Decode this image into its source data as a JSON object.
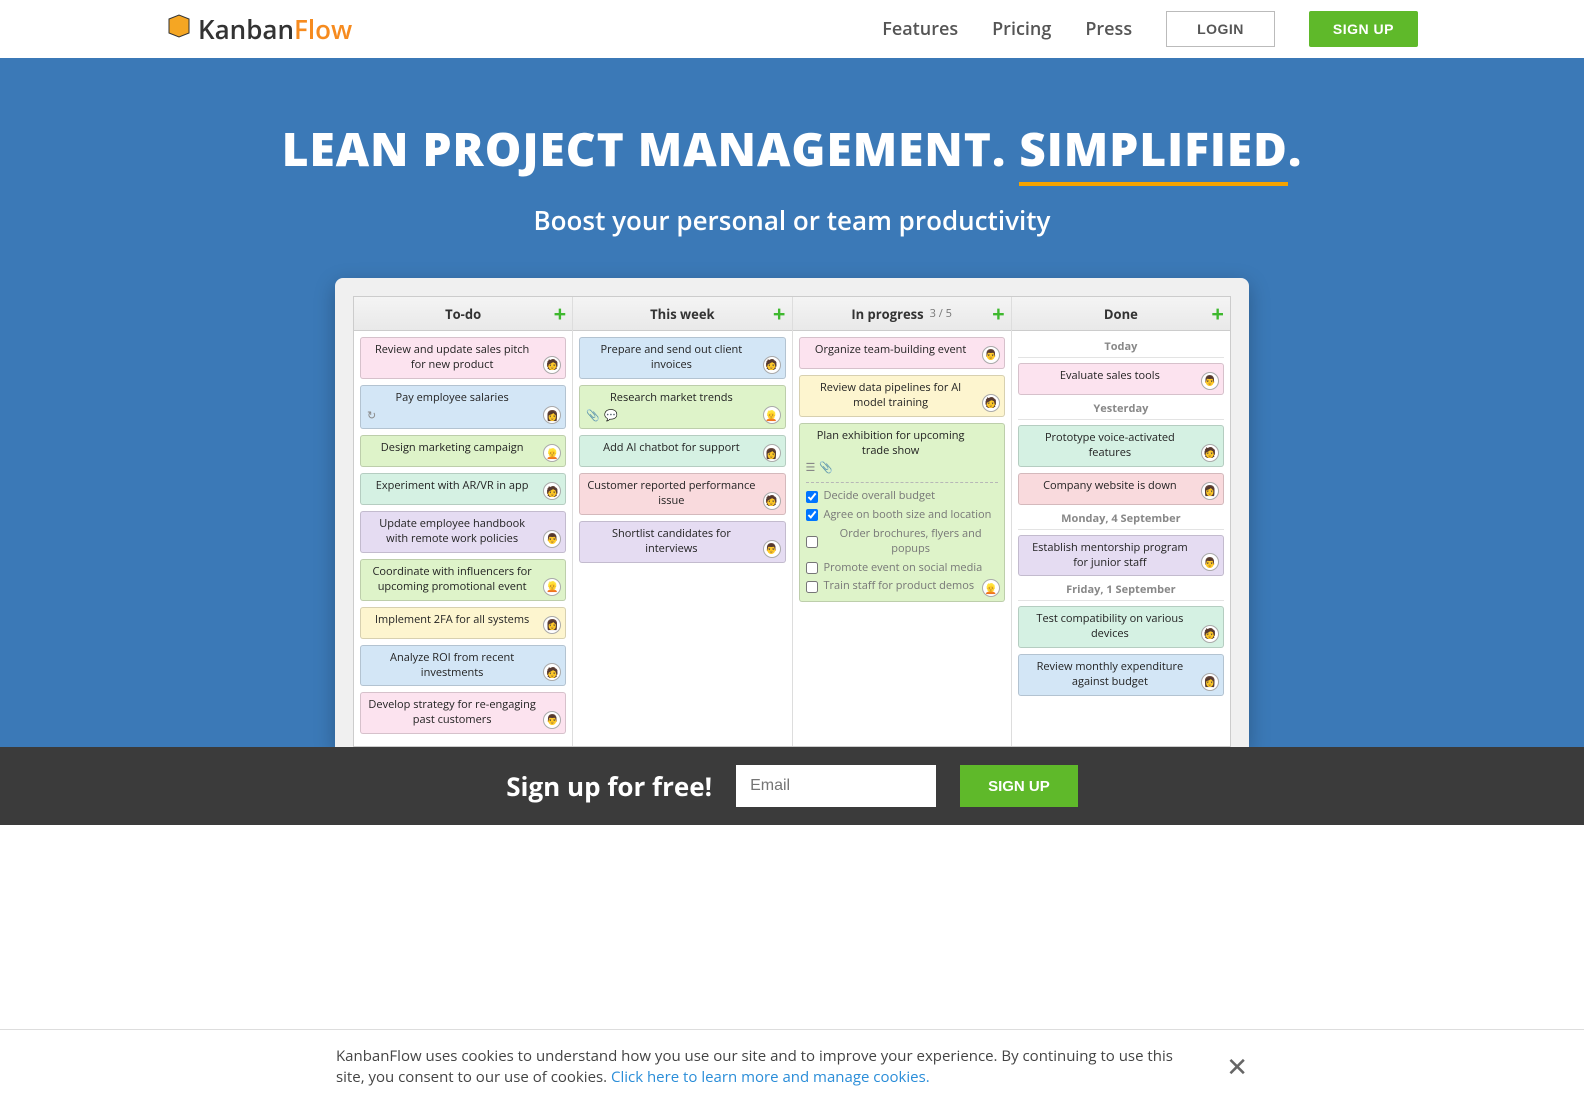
{
  "header": {
    "brand_a": "Kanban",
    "brand_b": "Flow",
    "nav": {
      "features": "Features",
      "pricing": "Pricing",
      "press": "Press"
    },
    "login": "LOGIN",
    "signup": "SIGN UP"
  },
  "hero": {
    "title_a": "LEAN PROJECT MANAGEMENT. ",
    "title_b": "SIMPLIFIED",
    "title_c": ".",
    "sub": "Boost your personal or team productivity"
  },
  "board": {
    "columns": [
      {
        "title": "To-do",
        "cards": [
          {
            "text": "Review and update sales pitch for new product",
            "color": "pink",
            "avatar": "🧑"
          },
          {
            "text": "Pay employee salaries",
            "color": "blue",
            "avatar": "👩",
            "icons": [
              "↻"
            ]
          },
          {
            "text": "Design marketing campaign",
            "color": "green",
            "avatar": "👱"
          },
          {
            "text": "Experiment with AR/VR in app",
            "color": "teal",
            "avatar": "🧑"
          },
          {
            "text": "Update employee handbook with remote work policies",
            "color": "purple",
            "avatar": "👨"
          },
          {
            "text": "Coordinate with influencers for upcoming promotional event",
            "color": "green",
            "avatar": "👱"
          },
          {
            "text": "Implement 2FA for all systems",
            "color": "yellow",
            "avatar": "👩"
          },
          {
            "text": "Analyze ROI from recent investments",
            "color": "blue",
            "avatar": "🧑"
          },
          {
            "text": "Develop strategy for re-engaging past customers",
            "color": "pink",
            "avatar": "👨"
          }
        ]
      },
      {
        "title": "This week",
        "cards": [
          {
            "text": "Prepare and send out client invoices",
            "color": "blue",
            "avatar": "🧑"
          },
          {
            "text": "Research market trends",
            "color": "green",
            "avatar": "👱",
            "icons": [
              "📎",
              "💬"
            ]
          },
          {
            "text": "Add AI chatbot for support",
            "color": "teal",
            "avatar": "👩"
          },
          {
            "text": "Customer reported performance issue",
            "color": "red",
            "avatar": "🧑"
          },
          {
            "text": "Shortlist candidates for interviews",
            "color": "purple",
            "avatar": "👨"
          }
        ]
      },
      {
        "title": "In progress",
        "limit": "3 / 5",
        "cards": [
          {
            "text": "Organize team-building event",
            "color": "pink",
            "avatar": "👨"
          },
          {
            "text": "Review data pipelines for AI model training",
            "color": "yellow",
            "avatar": "🧑"
          },
          {
            "text": "Plan exhibition for upcoming trade show",
            "color": "green",
            "avatar": "👱",
            "icons": [
              "☰",
              "📎"
            ],
            "subtasks": [
              {
                "done": true,
                "text": "Decide overall budget"
              },
              {
                "done": true,
                "text": "Agree on booth size and location"
              },
              {
                "done": false,
                "text": "Order brochures, flyers and popups"
              },
              {
                "done": false,
                "text": "Promote event on social media"
              },
              {
                "done": false,
                "text": "Train staff for product demos"
              }
            ]
          }
        ]
      },
      {
        "title": "Done",
        "groups": [
          {
            "label": "Today",
            "cards": [
              {
                "text": "Evaluate sales tools",
                "color": "pink",
                "avatar": "👨"
              }
            ]
          },
          {
            "label": "Yesterday",
            "cards": [
              {
                "text": "Prototype voice-activated features",
                "color": "teal",
                "avatar": "🧑"
              },
              {
                "text": "Company website is down",
                "color": "red",
                "avatar": "👩"
              }
            ]
          },
          {
            "label": "Monday, 4 September",
            "cards": [
              {
                "text": "Establish mentorship program for junior staff",
                "color": "purple",
                "avatar": "👨"
              }
            ]
          },
          {
            "label": "Friday, 1 September",
            "cards": [
              {
                "text": "Test compatibility on various devices",
                "color": "teal",
                "avatar": "🧑"
              },
              {
                "text": "Review monthly expenditure against budget",
                "color": "blue",
                "avatar": "👩"
              }
            ]
          }
        ]
      }
    ]
  },
  "signup": {
    "title": "Sign up for free!",
    "placeholder": "Email",
    "button": "SIGN UP"
  },
  "cookie": {
    "text": "KanbanFlow uses cookies to understand how you use our site and to improve your experience. By continuing to use this site, you consent to our use of cookies. ",
    "link": "Click here to learn more and manage cookies."
  }
}
